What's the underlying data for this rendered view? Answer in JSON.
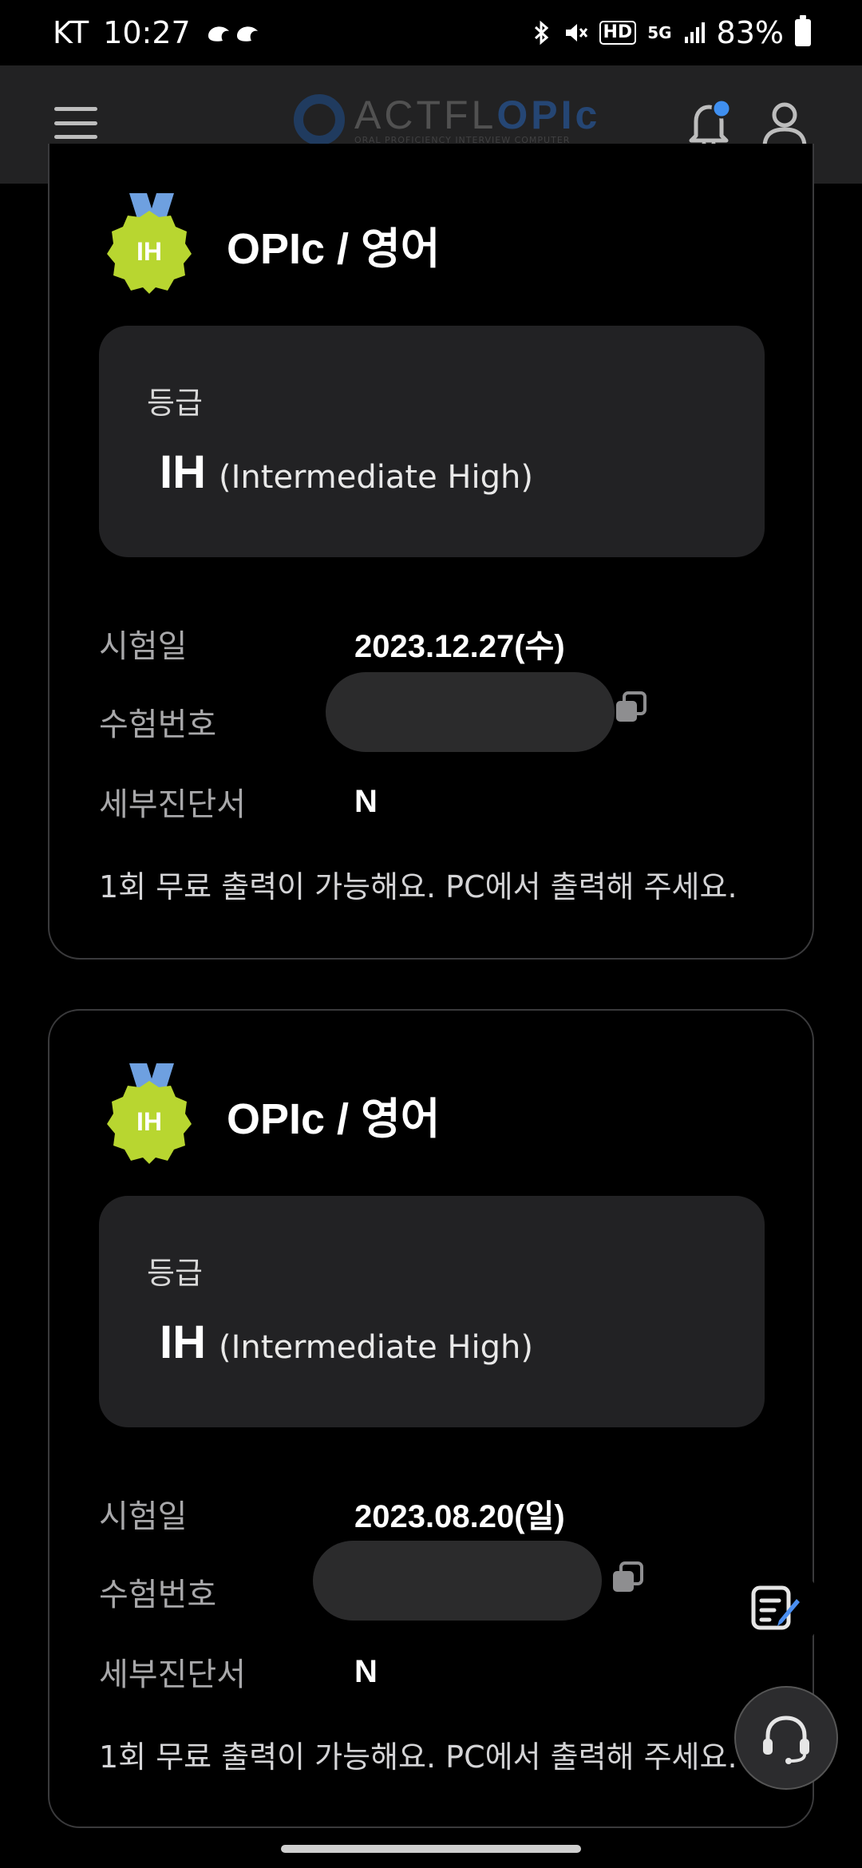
{
  "status_bar": {
    "carrier": "KT",
    "time": "10:27",
    "hd_badge": "HD",
    "network": "5G",
    "battery": "83%"
  },
  "header": {
    "logo_text_a": "ACTFL",
    "logo_text_b": "OPIc",
    "logo_subtitle": "ORAL PROFICIENCY INTERVIEW COMPUTER"
  },
  "colors": {
    "medal": "#b8d630",
    "ribbon": "#6ea0e0",
    "notification_dot": "#3f8ff0",
    "card_bg": "#222224"
  },
  "cards": [
    {
      "medal_label": "IH",
      "title": "OPIc / 영어",
      "grade_label": "등급",
      "grade_code": "IH",
      "grade_desc": "(Intermediate High)",
      "exam_date_label": "시험일",
      "exam_date": "2023.12.27(수)",
      "exam_number_label": "수험번호",
      "report_label": "세부진단서",
      "report_value": "N",
      "note": "1회 무료 출력이 가능해요. PC에서 출력해 주세요."
    },
    {
      "medal_label": "IH",
      "title": "OPIc / 영어",
      "grade_label": "등급",
      "grade_code": "IH",
      "grade_desc": "(Intermediate High)",
      "exam_date_label": "시험일",
      "exam_date": "2023.08.20(일)",
      "exam_number_label": "수험번호",
      "report_label": "세부진단서",
      "report_value": "N",
      "note": "1회 무료 출력이 가능해요. PC에서 출력해 주세요."
    }
  ]
}
